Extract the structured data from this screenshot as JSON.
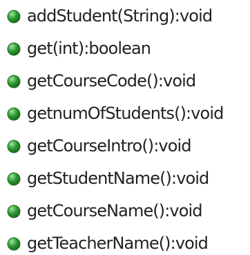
{
  "outline": {
    "icon": "public-method-icon",
    "icon_color": "#2f9a32",
    "methods": [
      {
        "label": "addStudent(String):void"
      },
      {
        "label": "get(int):boolean"
      },
      {
        "label": "getCourseCode():void"
      },
      {
        "label": "getnumOfStudents():void"
      },
      {
        "label": "getCourseIntro():void"
      },
      {
        "label": "getStudentName():void"
      },
      {
        "label": "getCourseName():void"
      },
      {
        "label": "getTeacherName():void"
      }
    ]
  }
}
